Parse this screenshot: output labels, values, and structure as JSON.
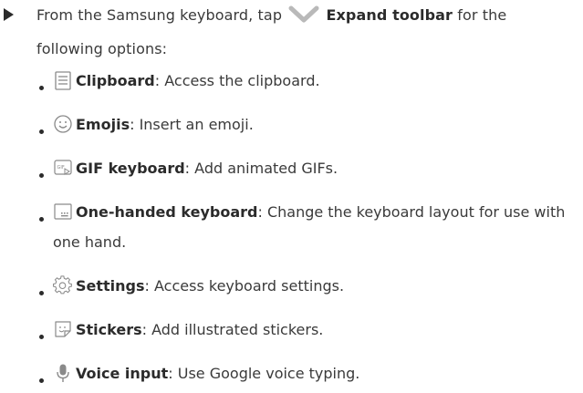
{
  "intro": {
    "prefix": "From the Samsung keyboard, tap",
    "action": "Expand toolbar",
    "suffix": "for the following options:"
  },
  "items": [
    {
      "icon": "clipboard-icon",
      "label": "Clipboard",
      "desc": ": Access the clipboard."
    },
    {
      "icon": "emoji-icon",
      "label": "Emojis",
      "desc": ": Insert an emoji."
    },
    {
      "icon": "gif-icon",
      "label": "GIF keyboard",
      "desc": ": Add animated GIFs."
    },
    {
      "icon": "one-handed-keyboard-icon",
      "label": "One-handed keyboard",
      "desc": ": Change the keyboard layout for use with one hand."
    },
    {
      "icon": "settings-gear-icon",
      "label": "Settings",
      "desc": ": Access keyboard settings."
    },
    {
      "icon": "sticker-icon",
      "label": "Stickers",
      "desc": ": Add illustrated stickers."
    },
    {
      "icon": "microphone-icon",
      "label": "Voice input",
      "desc": ": Use Google voice typing."
    }
  ],
  "colors": {
    "text": "#3a3a3a",
    "icon": "#8a8a8a",
    "chevron": "#b9b9b9"
  }
}
